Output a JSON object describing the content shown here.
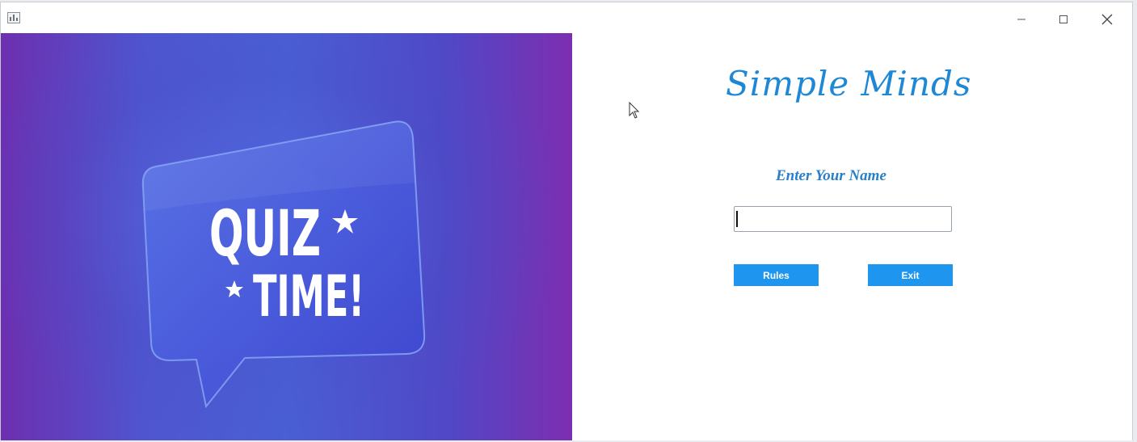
{
  "window": {
    "icon": "java-app-icon",
    "controls": {
      "minimize": "minimize-icon",
      "maximize": "maximize-icon",
      "close": "close-icon"
    }
  },
  "banner": {
    "word1": "QUIZ",
    "word2": "TIME!",
    "icons": [
      "star-icon",
      "star-icon"
    ],
    "colors": {
      "purple": "#6d2fb0",
      "blue": "#4a5fd4",
      "bubble": "#4757d8"
    }
  },
  "form": {
    "title": "Simple Minds",
    "name_label": "Enter Your Name",
    "name_value": "",
    "rules_label": "Rules",
    "exit_label": "Exit",
    "accent": "#1e96f0"
  }
}
